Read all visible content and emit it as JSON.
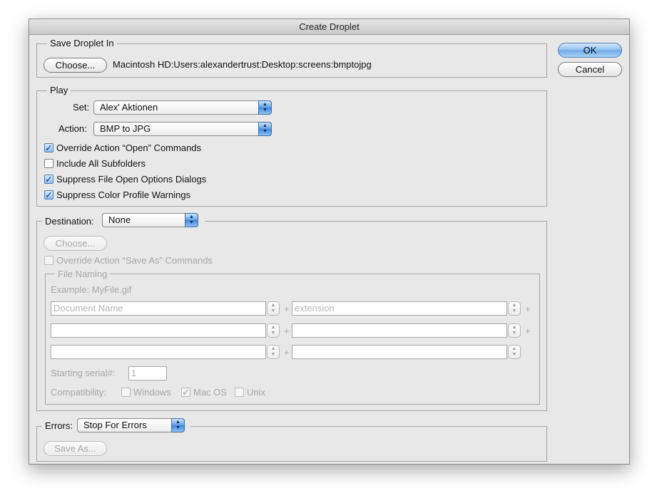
{
  "window": {
    "title": "Create Droplet"
  },
  "buttons": {
    "ok": "OK",
    "cancel": "Cancel"
  },
  "save_in": {
    "legend": "Save Droplet In",
    "choose_label": "Choose...",
    "path": "Macintosh HD:Users:alexandertrust:Desktop:screens:bmptojpg"
  },
  "play": {
    "legend": "Play",
    "set_label": "Set:",
    "set_value": "Alex' Aktionen",
    "action_label": "Action:",
    "action_value": "BMP to JPG",
    "options": [
      {
        "label": "Override Action “Open” Commands",
        "checked": true
      },
      {
        "label": "Include All Subfolders",
        "checked": false
      },
      {
        "label": "Suppress File Open Options Dialogs",
        "checked": true
      },
      {
        "label": "Suppress Color Profile Warnings",
        "checked": true
      }
    ]
  },
  "destination": {
    "label": "Destination:",
    "value": "None",
    "choose_label": "Choose...",
    "override_label": "Override Action “Save As” Commands",
    "file_naming": {
      "legend": "File Naming",
      "example": "Example: MyFile.gif",
      "rows": [
        {
          "left": "Document Name",
          "right": "extension"
        },
        {
          "left": "",
          "right": ""
        },
        {
          "left": "",
          "right": ""
        }
      ],
      "plus": "+",
      "serial_label": "Starting serial#:",
      "serial_value": "1",
      "compat_label": "Compatibility:",
      "compat": [
        {
          "label": "Windows",
          "checked": false
        },
        {
          "label": "Mac OS",
          "checked": true
        },
        {
          "label": "Unix",
          "checked": false
        }
      ]
    }
  },
  "errors": {
    "label": "Errors:",
    "value": "Stop For Errors",
    "save_as_label": "Save As..."
  },
  "icons": {
    "popup_arrows": "▲▼",
    "check": "✓"
  }
}
